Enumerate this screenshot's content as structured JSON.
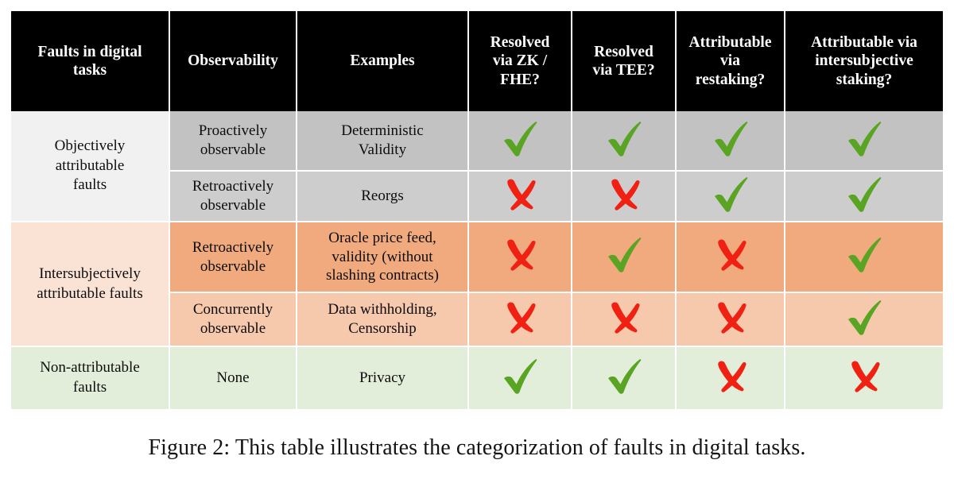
{
  "figure": {
    "caption": "Figure 2: This table illustrates the categorization of faults in digital tasks."
  },
  "colors": {
    "header_bg": "#000000",
    "header_text": "#ffffff",
    "check_green": "#5aa423",
    "cross_red": "#f02112",
    "objective_category_bg": "#f1f1f1",
    "objective_row_a_bg": "#c2c2c2",
    "objective_row_b_bg": "#cdcdcd",
    "intersubjective_category_bg": "#fae2d5",
    "intersubjective_row_a_bg": "#f0aa7e",
    "intersubjective_row_b_bg": "#f7c9ac",
    "nonattributable_bg": "#e2eed9",
    "grid_line": "#ffffff"
  },
  "table": {
    "columns": [
      "Faults in digital tasks",
      "Observability",
      "Examples",
      "Resolved via ZK / FHE?",
      "Resolved via TEE?",
      "Attributable via restaking?",
      "Attributable via intersubjective staking?"
    ],
    "column_lines": [
      [
        "Faults in digital",
        "tasks"
      ],
      [
        "Observability"
      ],
      [
        "Examples"
      ],
      [
        "Resolved",
        "via ZK /",
        "FHE?"
      ],
      [
        "Resolved",
        "via TEE?"
      ],
      [
        "Attributable",
        "via",
        "restaking?"
      ],
      [
        "Attributable via",
        "intersubjective",
        "staking?"
      ]
    ],
    "groups": [
      {
        "category": "Objectively attributable faults",
        "category_lines": [
          "Objectively",
          "attributable",
          "faults"
        ],
        "rows": [
          {
            "observability": "Proactively observable",
            "observability_lines": [
              "Proactively",
              "observable"
            ],
            "examples": "Deterministic Validity",
            "examples_lines": [
              "Deterministic",
              "Validity"
            ],
            "marks": [
              "check",
              "check",
              "check",
              "check"
            ]
          },
          {
            "observability": "Retroactively observable",
            "observability_lines": [
              "Retroactively",
              "observable"
            ],
            "examples": "Reorgs",
            "examples_lines": [
              "Reorgs"
            ],
            "marks": [
              "cross",
              "cross",
              "check",
              "check"
            ]
          }
        ]
      },
      {
        "category": "Intersubjectively attributable faults",
        "category_lines": [
          "Intersubjectively",
          "attributable faults"
        ],
        "rows": [
          {
            "observability": "Retroactively observable",
            "observability_lines": [
              "Retroactively",
              "observable"
            ],
            "examples": "Oracle price feed, validity (without slashing contracts)",
            "examples_lines": [
              "Oracle price feed,",
              "validity (without",
              "slashing contracts)"
            ],
            "marks": [
              "cross",
              "check",
              "cross",
              "check"
            ]
          },
          {
            "observability": "Concurrently observable",
            "observability_lines": [
              "Concurrently",
              "observable"
            ],
            "examples": "Data withholding, Censorship",
            "examples_lines": [
              "Data withholding,",
              "Censorship"
            ],
            "marks": [
              "cross",
              "cross",
              "cross",
              "check"
            ]
          }
        ]
      },
      {
        "category": "Non-attributable faults",
        "category_lines": [
          "Non-attributable",
          "faults"
        ],
        "rows": [
          {
            "observability": "None",
            "observability_lines": [
              "None"
            ],
            "examples": "Privacy",
            "examples_lines": [
              "Privacy"
            ],
            "marks": [
              "check",
              "check",
              "cross",
              "cross"
            ]
          }
        ]
      }
    ]
  },
  "icons": {
    "check": "check-mark-icon",
    "cross": "cross-mark-icon"
  }
}
